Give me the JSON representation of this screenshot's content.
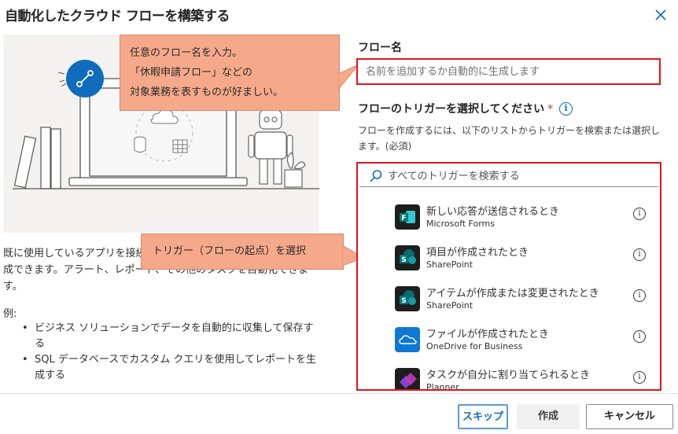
{
  "dialog": {
    "title": "自動化したクラウド フローを構築する",
    "close_icon": "close-icon"
  },
  "illustration": {
    "icon_names": [
      "flow-badge-icon",
      "laptop-illustration",
      "database-icon",
      "table-icon",
      "cloud-icon",
      "robot-illustration",
      "books-illustration",
      "plant-illustration"
    ],
    "accent_color": "#0f6cbd"
  },
  "left": {
    "description": "既に使用しているアプリを接続して、自動化されたワークフローを作成できます。アラート、レポート、その他のタスクを自動化できます。",
    "examples_title": "例:",
    "examples": [
      "ビジネス ソリューションでデータを自動的に収集して保存する",
      "SQL データベースでカスタム クエリを使用してレポートを生成する"
    ]
  },
  "callouts": {
    "name_hint": [
      "任意のフロー名を入力。",
      "「休暇申請フロー」などの",
      "対象業務を表すものが好ましい。"
    ],
    "trigger_hint": "トリガー（フローの起点）を選択",
    "color": "#f6a98a"
  },
  "form": {
    "name_label": "フロー名",
    "name_placeholder": "名前を追加するか自動的に生成します",
    "trigger_label": "フローのトリガーを選択してください",
    "required_mark": "*",
    "info_icon": "info-icon",
    "trigger_description": "フローを作成するには、以下のリストからトリガーを検索または選択します。(必須)",
    "search_placeholder": "すべてのトリガーを検索する",
    "highlight_color": "#e0141e"
  },
  "triggers": [
    {
      "name": "新しい応答が送信されるとき",
      "connector": "Microsoft Forms",
      "icon": "forms-icon",
      "color": "#0a7b71"
    },
    {
      "name": "項目が作成されたとき",
      "connector": "SharePoint",
      "icon": "sharepoint-icon",
      "color": "#036c70"
    },
    {
      "name": "アイテムが作成または変更されたとき",
      "connector": "SharePoint",
      "icon": "sharepoint-icon",
      "color": "#036c70"
    },
    {
      "name": "ファイルが作成されたとき",
      "connector": "OneDrive for Business",
      "icon": "onedrive-icon",
      "color": "#0f78d4"
    },
    {
      "name": "タスクが自分に割り当てられるとき",
      "connector": "Planner",
      "icon": "planner-icon",
      "color": "#7b45d8"
    }
  ],
  "footer": {
    "skip_label": "スキップ",
    "create_label": "作成",
    "cancel_label": "キャンセル"
  }
}
